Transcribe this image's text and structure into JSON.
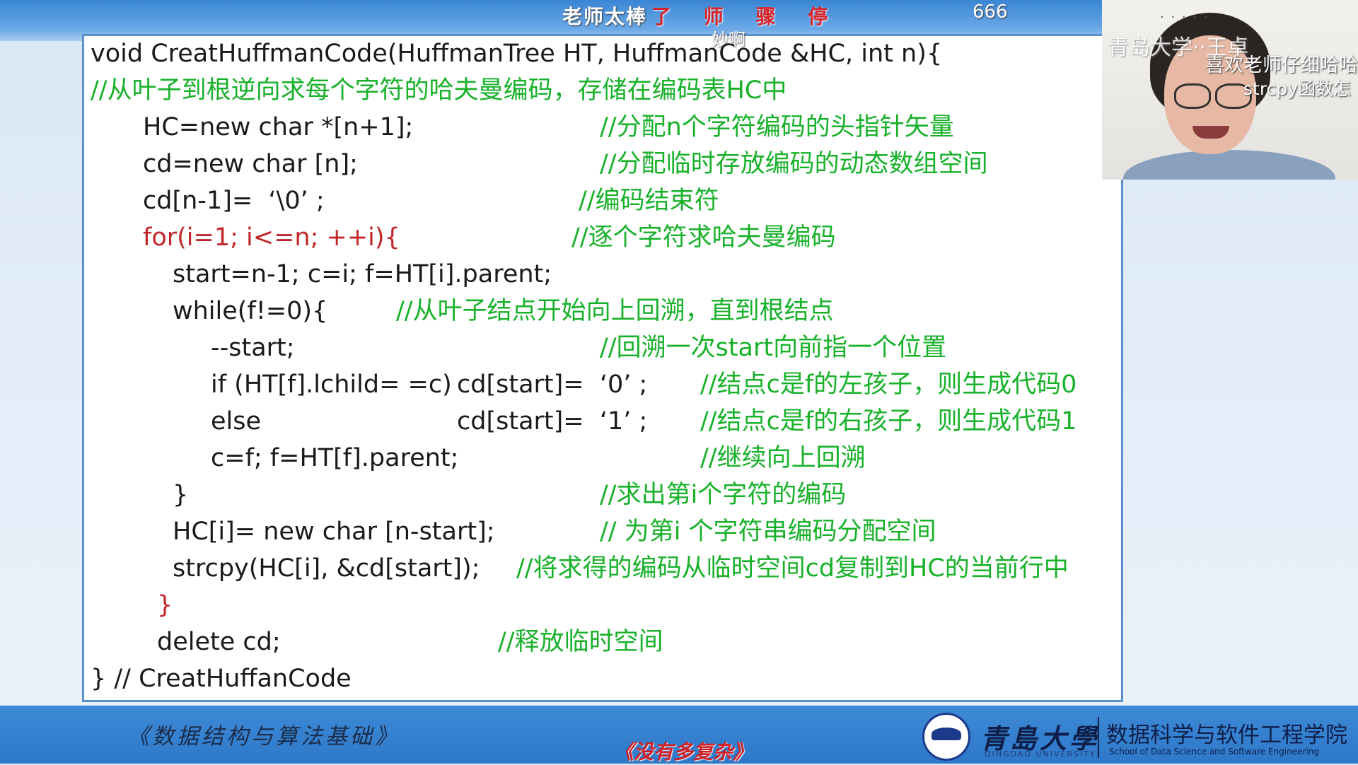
{
  "overlay": {
    "top_prefix": "老师太棒",
    "top_red": "了 师 骤 停",
    "top_small": "妙啊",
    "page_number": "666",
    "bottom": "《没有多复杂》",
    "cam_dots": "· · · · ·",
    "cam_watermark": "青岛大学··王卓",
    "cam_line1": "喜欢老师仔细哈哈",
    "cam_line2": "strcpy函数怎"
  },
  "code": {
    "l1": "void CreatHuffmanCode(HuffmanTree HT, HuffmanCode &HC, int n){",
    "l2": "//从叶子到根逆向求每个字符的哈夫曼编码，存储在编码表HC中",
    "l3": "HC=new char *[n+1];",
    "l3c": "//分配n个字符编码的头指针矢量",
    "l4": "cd=new char [n];",
    "l4c": "//分配临时存放编码的动态数组空间",
    "l5": "cd[n-1]=  ‘\\0’ ;",
    "l5c": "//编码结束符",
    "l6": "for(i=1; i<=n; ++i){",
    "l6c": "//逐个字符求哈夫曼编码",
    "l7": "start=n-1; c=i; f=HT[i].parent;",
    "l8": "while(f!=0){",
    "l8c": "//从叶子结点开始向上回溯，直到根结点",
    "l9": "--start;",
    "l9c": "//回溯一次start向前指一个位置",
    "l10a": "if (HT[f].lchild= =c)",
    "l10b": "cd[start]=  ‘0’ ;",
    "l10c": "//结点c是f的左孩子，则生成代码0",
    "l11a": "else",
    "l11b": "cd[start]=  ‘1’ ;",
    "l11c": "//结点c是f的右孩子，则生成代码1",
    "l12": "c=f; f=HT[f].parent;",
    "l12c": "//继续向上回溯",
    "l13": "}",
    "l13c": "//求出第i个字符的编码",
    "l14": "HC[i]= new char [n-start];",
    "l14c": "// 为第i 个字符串编码分配空间",
    "l15": "strcpy(HC[i], &cd[start]);",
    "l15c": "//将求得的编码从临时空间cd复制到HC的当前行中",
    "l16": "}",
    "l17": "delete cd;",
    "l17c": "//释放临时空间",
    "l18": "} // CreatHuffanCode"
  },
  "footer": {
    "course": "《数据结构与算法基础》",
    "university": "青島大學",
    "university_en": "QINGDAO UNIVERSITY",
    "college": "数据科学与软件工程学院",
    "college_en": "School of Data Science and Software Engineering"
  },
  "colors": {
    "code_text": "#1a1a1a",
    "comment": "#18b12a",
    "keyword_red": "#c0262b",
    "band_blue": "#3a86d4"
  }
}
